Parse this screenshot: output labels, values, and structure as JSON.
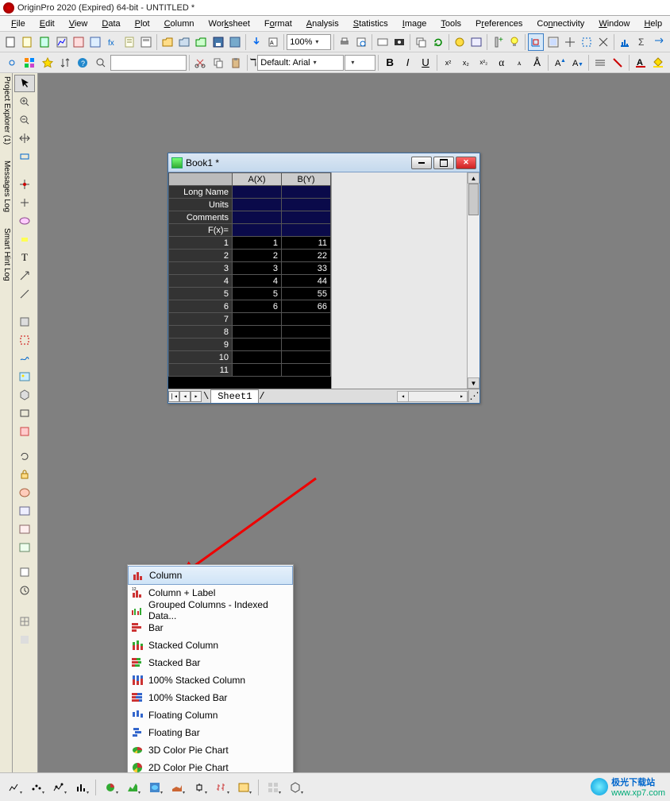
{
  "app": {
    "title": "OriginPro 2020 (Expired) 64-bit - UNTITLED *"
  },
  "menu": {
    "items": [
      "File",
      "Edit",
      "View",
      "Data",
      "Plot",
      "Column",
      "Worksheet",
      "Format",
      "Analysis",
      "Statistics",
      "Image",
      "Tools",
      "Preferences",
      "Connectivity",
      "Window",
      "Help"
    ]
  },
  "toolbar1": {
    "zoom": "100%"
  },
  "toolbar2": {
    "font_label": "Default: Arial"
  },
  "side_tabs": {
    "project_explorer": "Project Explorer (1)",
    "messages_log": "Messages Log",
    "smart_hint": "Smart Hint Log"
  },
  "book": {
    "title": "Book1 *",
    "columns": [
      "A(X)",
      "B(Y)"
    ],
    "meta_rows": [
      "Long Name",
      "Units",
      "Comments",
      "F(x)="
    ],
    "rows": [
      {
        "n": "1",
        "a": "1",
        "b": "11"
      },
      {
        "n": "2",
        "a": "2",
        "b": "22"
      },
      {
        "n": "3",
        "a": "3",
        "b": "33"
      },
      {
        "n": "4",
        "a": "4",
        "b": "44"
      },
      {
        "n": "5",
        "a": "5",
        "b": "55"
      },
      {
        "n": "6",
        "a": "6",
        "b": "66"
      },
      {
        "n": "7",
        "a": "",
        "b": ""
      },
      {
        "n": "8",
        "a": "",
        "b": ""
      },
      {
        "n": "9",
        "a": "",
        "b": ""
      },
      {
        "n": "10",
        "a": "",
        "b": ""
      },
      {
        "n": "11",
        "a": "",
        "b": ""
      }
    ],
    "sheet": "Sheet1"
  },
  "popup": {
    "items": [
      {
        "label": "Column",
        "hover": true
      },
      {
        "label": "Column + Label"
      },
      {
        "label": "Grouped Columns - Indexed Data..."
      },
      {
        "label": "Bar"
      },
      {
        "label": "Stacked Column"
      },
      {
        "label": "Stacked Bar"
      },
      {
        "label": "100% Stacked Column"
      },
      {
        "label": "100% Stacked Bar"
      },
      {
        "label": "Floating Column"
      },
      {
        "label": "Floating Bar"
      },
      {
        "label": "3D Color Pie Chart"
      },
      {
        "label": "2D Color Pie Chart"
      }
    ]
  },
  "watermark": {
    "name": "极光下载站",
    "url": "www.xp7.com"
  }
}
